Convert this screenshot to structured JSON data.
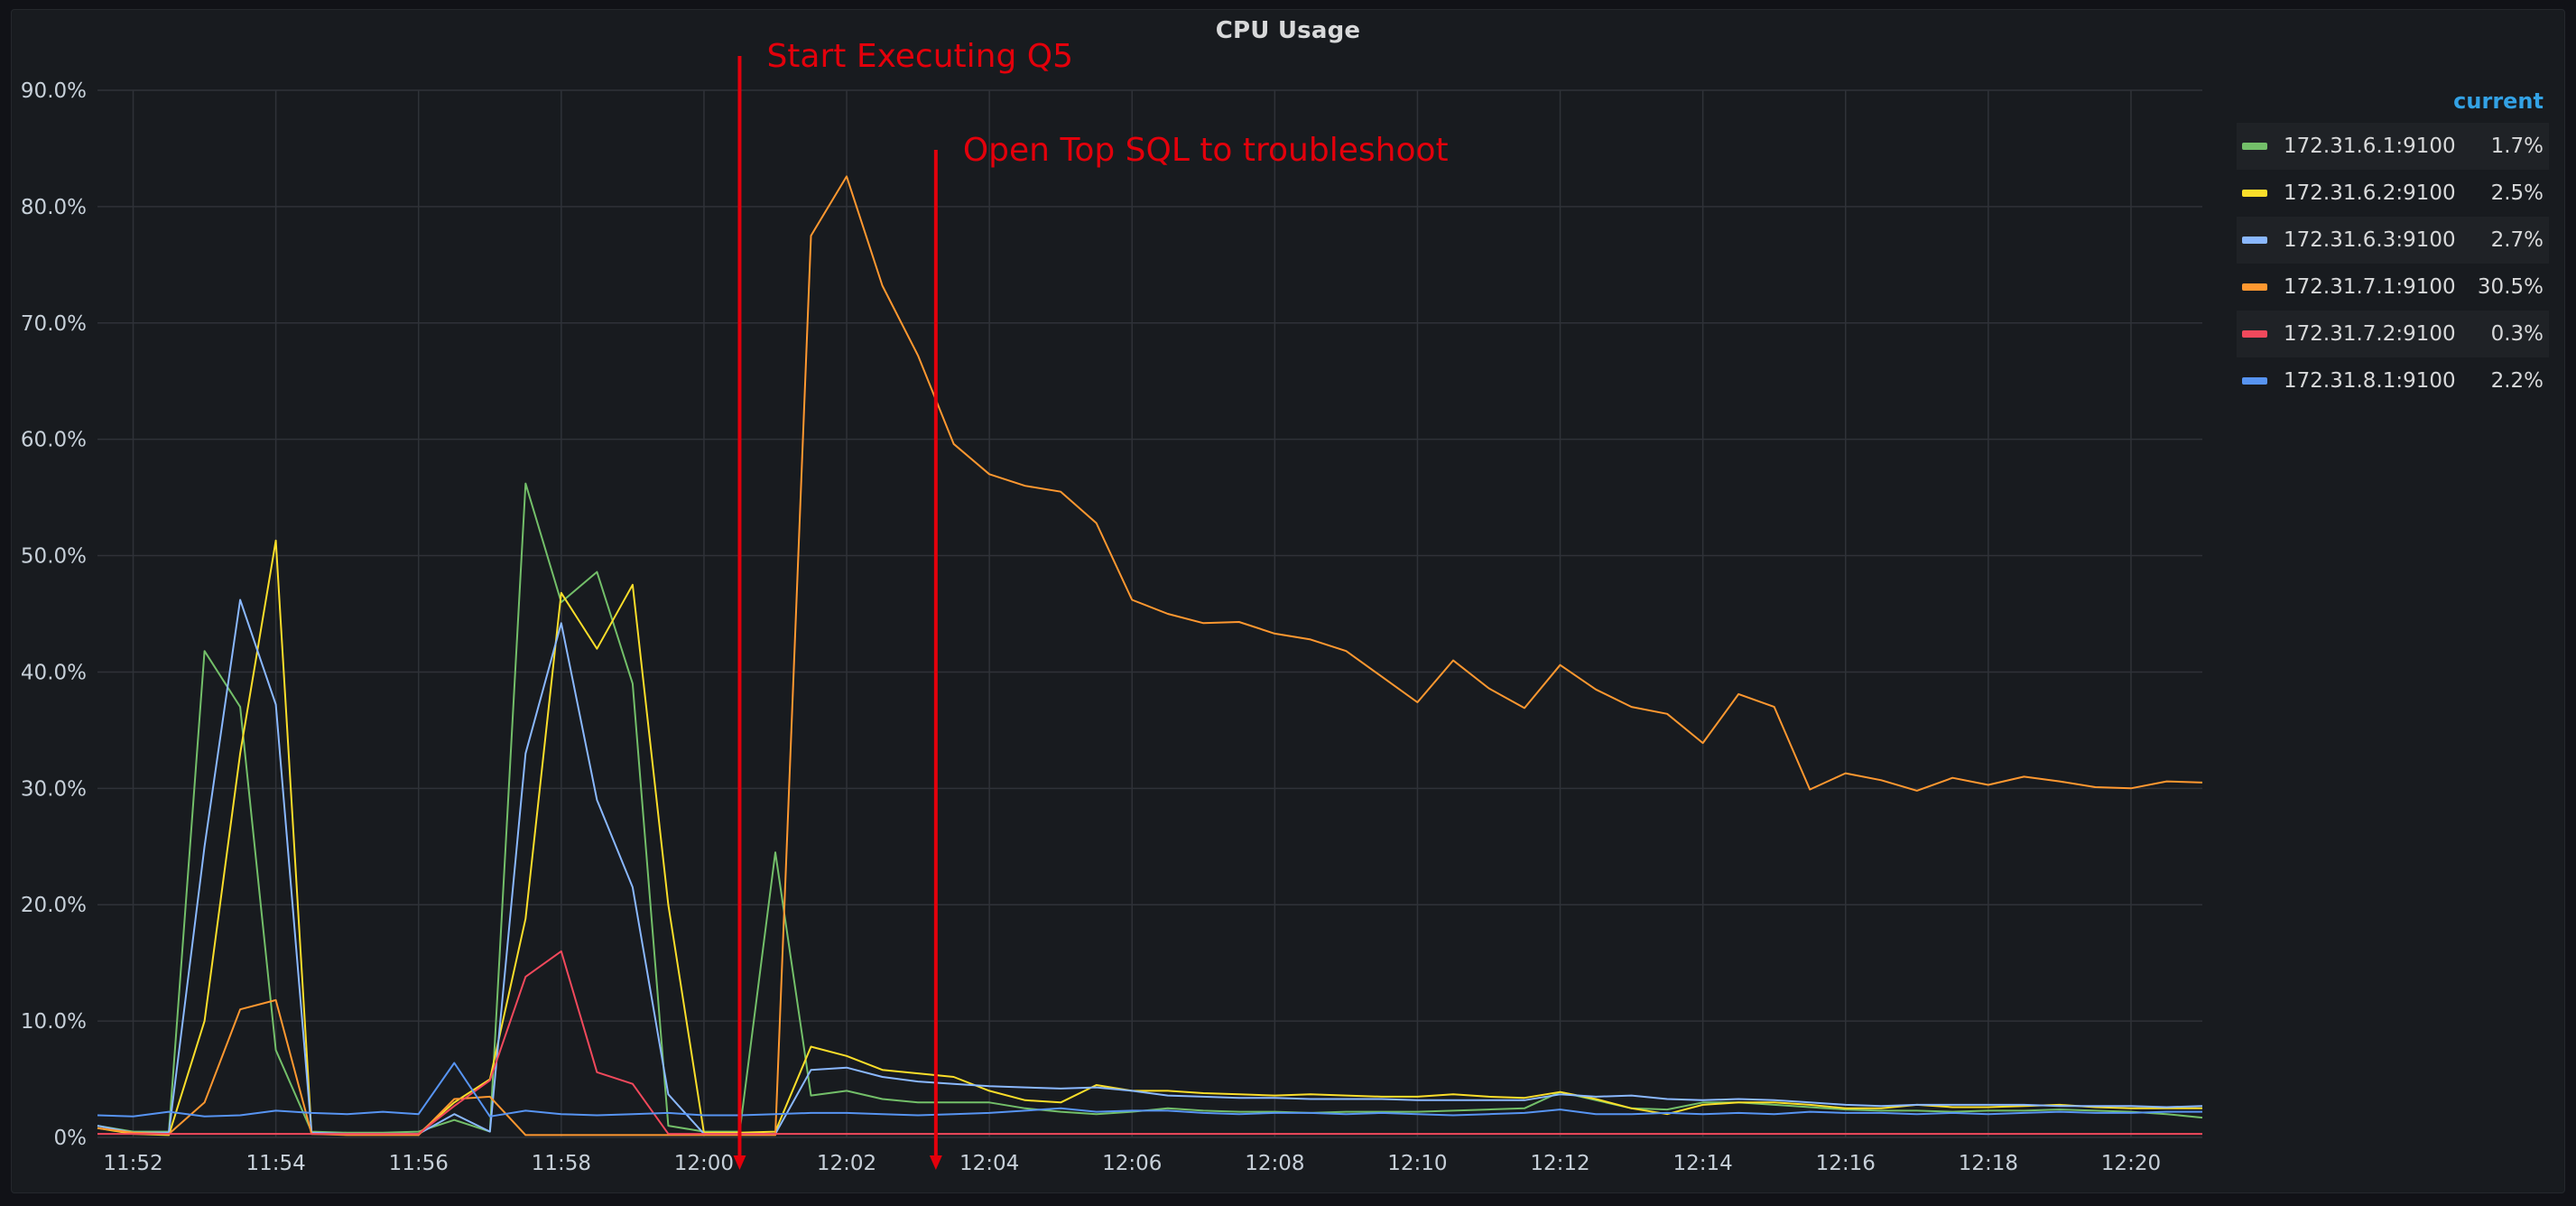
{
  "chart_data": {
    "type": "line",
    "title": "CPU Usage",
    "x_range": [
      "11:51:30",
      "12:21:00"
    ],
    "x_ticks": [
      "11:52",
      "11:54",
      "11:56",
      "11:58",
      "12:00",
      "12:02",
      "12:04",
      "12:06",
      "12:08",
      "12:10",
      "12:12",
      "12:14",
      "12:16",
      "12:18",
      "12:20"
    ],
    "y_ticks": [
      "0%",
      "10.0%",
      "20.0%",
      "30.0%",
      "40.0%",
      "50.0%",
      "60.0%",
      "70.0%",
      "80.0%",
      "90.0%"
    ],
    "ylim": [
      0,
      90
    ],
    "grid": true,
    "legend_position": "right",
    "x": [
      "11:51:30",
      "11:52",
      "11:52:30",
      "11:53",
      "11:53:30",
      "11:54",
      "11:54:30",
      "11:55",
      "11:55:30",
      "11:56",
      "11:56:30",
      "11:57",
      "11:57:30",
      "11:58",
      "11:58:30",
      "11:59",
      "11:59:30",
      "12:00",
      "12:00:30",
      "12:01",
      "12:01:30",
      "12:02",
      "12:02:30",
      "12:03",
      "12:03:30",
      "12:04",
      "12:04:30",
      "12:05",
      "12:05:30",
      "12:06",
      "12:06:30",
      "12:07",
      "12:07:30",
      "12:08",
      "12:08:30",
      "12:09",
      "12:09:30",
      "12:10",
      "12:10:30",
      "12:11",
      "12:11:30",
      "12:12",
      "12:12:30",
      "12:13",
      "12:13:30",
      "12:14",
      "12:14:30",
      "12:15",
      "12:15:30",
      "12:16",
      "12:16:30",
      "12:17",
      "12:17:30",
      "12:18",
      "12:18:30",
      "12:19",
      "12:19:30",
      "12:20",
      "12:20:30",
      "12:21"
    ],
    "series": [
      {
        "name": "172.31.6.1:9100",
        "color": "#73bf69",
        "current": "1.7%",
        "values": [
          1.0,
          0.5,
          0.5,
          41.8,
          37.0,
          7.5,
          0.5,
          0.4,
          0.4,
          0.5,
          1.5,
          0.5,
          56.2,
          46.0,
          48.6,
          39.0,
          1.0,
          0.5,
          0.5,
          24.5,
          3.6,
          4.0,
          3.3,
          3.0,
          3.0,
          3.0,
          2.5,
          2.2,
          2.0,
          2.2,
          2.5,
          2.3,
          2.2,
          2.2,
          2.1,
          2.2,
          2.2,
          2.2,
          2.3,
          2.4,
          2.5,
          3.9,
          3.2,
          2.5,
          2.4,
          3.0,
          3.0,
          2.8,
          2.6,
          2.4,
          2.3,
          2.3,
          2.2,
          2.3,
          2.3,
          2.4,
          2.3,
          2.2,
          2.0,
          1.7
        ]
      },
      {
        "name": "172.31.6.2:9100",
        "color": "#fade2a",
        "current": "2.5%",
        "values": [
          0.8,
          0.3,
          0.2,
          10.0,
          33.0,
          51.3,
          0.3,
          0.3,
          0.3,
          0.3,
          3.0,
          5.0,
          18.8,
          46.8,
          42.0,
          47.5,
          20.0,
          0.4,
          0.4,
          0.5,
          7.8,
          7.0,
          5.8,
          5.5,
          5.2,
          4.0,
          3.2,
          3.0,
          4.5,
          4.0,
          4.0,
          3.8,
          3.7,
          3.6,
          3.7,
          3.6,
          3.5,
          3.5,
          3.7,
          3.5,
          3.4,
          3.9,
          3.3,
          2.5,
          2.0,
          2.8,
          3.0,
          3.0,
          2.8,
          2.5,
          2.5,
          2.8,
          2.6,
          2.6,
          2.7,
          2.8,
          2.6,
          2.5,
          2.5,
          2.5
        ]
      },
      {
        "name": "172.31.6.3:9100",
        "color": "#8ab8ff",
        "current": "2.7%",
        "values": [
          1.0,
          0.4,
          0.4,
          25.0,
          46.2,
          37.2,
          0.4,
          0.3,
          0.3,
          0.3,
          2.0,
          0.5,
          33.0,
          44.2,
          29.0,
          21.5,
          3.7,
          0.3,
          0.3,
          0.3,
          5.8,
          6.0,
          5.2,
          4.8,
          4.6,
          4.4,
          4.3,
          4.2,
          4.3,
          4.0,
          3.6,
          3.5,
          3.4,
          3.4,
          3.3,
          3.3,
          3.3,
          3.2,
          3.2,
          3.2,
          3.2,
          3.7,
          3.5,
          3.6,
          3.3,
          3.2,
          3.3,
          3.2,
          3.0,
          2.8,
          2.7,
          2.8,
          2.8,
          2.8,
          2.8,
          2.7,
          2.7,
          2.7,
          2.6,
          2.7
        ]
      },
      {
        "name": "172.31.7.1:9100",
        "color": "#ff9830",
        "current": "30.5%",
        "values": [
          0.8,
          0.4,
          0.3,
          3.0,
          11.0,
          11.8,
          0.3,
          0.2,
          0.2,
          0.2,
          3.3,
          3.5,
          0.2,
          0.2,
          0.2,
          0.2,
          0.2,
          0.2,
          0.2,
          0.2,
          77.5,
          82.6,
          73.2,
          67.2,
          59.6,
          57.0,
          56.0,
          55.5,
          52.8,
          46.2,
          45.0,
          44.2,
          44.3,
          43.3,
          42.8,
          41.8,
          39.6,
          37.4,
          41.0,
          38.6,
          36.9,
          40.6,
          38.5,
          37.0,
          36.4,
          33.9,
          38.1,
          37.0,
          29.9,
          31.3,
          30.7,
          29.8,
          30.9,
          30.3,
          31.0,
          30.6,
          30.1,
          30.0,
          30.6,
          30.5
        ]
      },
      {
        "name": "172.31.7.2:9100",
        "color": "#f2495c",
        "current": "0.3%",
        "values": [
          0.3,
          0.3,
          0.3,
          0.3,
          0.3,
          0.3,
          0.3,
          0.3,
          0.3,
          0.3,
          2.7,
          4.9,
          13.8,
          16.0,
          5.6,
          4.6,
          0.3,
          0.3,
          0.3,
          0.3,
          0.3,
          0.3,
          0.3,
          0.3,
          0.3,
          0.3,
          0.3,
          0.3,
          0.3,
          0.3,
          0.3,
          0.3,
          0.3,
          0.3,
          0.3,
          0.3,
          0.3,
          0.3,
          0.3,
          0.3,
          0.3,
          0.3,
          0.3,
          0.3,
          0.3,
          0.3,
          0.3,
          0.3,
          0.3,
          0.3,
          0.3,
          0.3,
          0.3,
          0.3,
          0.3,
          0.3,
          0.3,
          0.3,
          0.3,
          0.3
        ]
      },
      {
        "name": "172.31.8.1:9100",
        "color": "#5794f2",
        "current": "2.2%",
        "values": [
          1.9,
          1.8,
          2.2,
          1.8,
          1.9,
          2.3,
          2.1,
          2.0,
          2.2,
          2.0,
          6.4,
          1.8,
          2.3,
          2.0,
          1.9,
          2.0,
          2.1,
          1.9,
          1.9,
          2.0,
          2.1,
          2.1,
          2.0,
          1.9,
          2.0,
          2.1,
          2.3,
          2.5,
          2.2,
          2.3,
          2.3,
          2.1,
          2.0,
          2.1,
          2.1,
          2.0,
          2.1,
          2.0,
          1.9,
          2.0,
          2.1,
          2.4,
          2.0,
          2.0,
          2.1,
          2.0,
          2.1,
          2.0,
          2.2,
          2.1,
          2.1,
          2.0,
          2.1,
          2.0,
          2.1,
          2.2,
          2.1,
          2.1,
          2.2,
          2.2
        ]
      }
    ],
    "annotations": [
      {
        "text": "Start Executing Q5",
        "time": "12:00:30"
      },
      {
        "text": "Open Top SQL to troubleshoot",
        "time": "12:03:15"
      }
    ]
  },
  "legend": {
    "header": "current"
  },
  "colors": {
    "annotation": "#e3000b",
    "grid": "#2f3238",
    "axis_text": "#c7d0d9"
  }
}
